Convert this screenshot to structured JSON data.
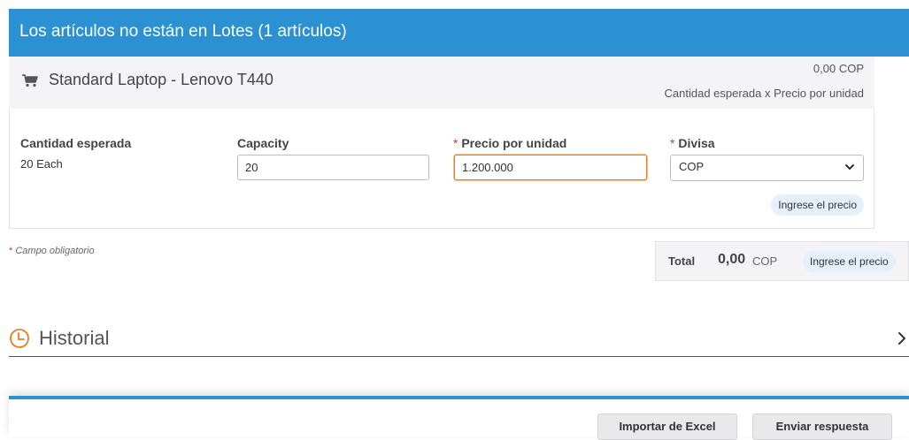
{
  "header": {
    "title": "Los artículos no están en Lotes (1 artículos)"
  },
  "item": {
    "icon": "cart-icon",
    "name": "Standard Laptop - Lenovo T440",
    "price": "0,00 COP",
    "formula": "Cantidad esperada x Precio por unidad"
  },
  "fields": {
    "expected_qty_label": "Cantidad esperada",
    "expected_qty_value": "20 Each",
    "capacity_label": "Capacity",
    "capacity_value": "20",
    "unit_price_label": "Precio por unidad",
    "unit_price_value": "1.200.000",
    "currency_label": "Divisa",
    "currency_value": "COP",
    "required_marker": "*",
    "enter_price_pill": "Ingrese el precio"
  },
  "required_note": {
    "star": "*",
    "text": "Campo obligatorio"
  },
  "total": {
    "label": "Total",
    "amount": "0,00",
    "currency": "COP",
    "pill": "Ingrese el precio"
  },
  "history": {
    "icon": "clock-icon",
    "title": "Historial"
  },
  "footer": {
    "import_label": "Importar de Excel",
    "send_label": "Enviar respuesta"
  },
  "colors": {
    "header_bg": "#2c91d2",
    "required": "#d9342b",
    "active_border": "#e67e22",
    "pill_bg": "#e6f0fb"
  }
}
